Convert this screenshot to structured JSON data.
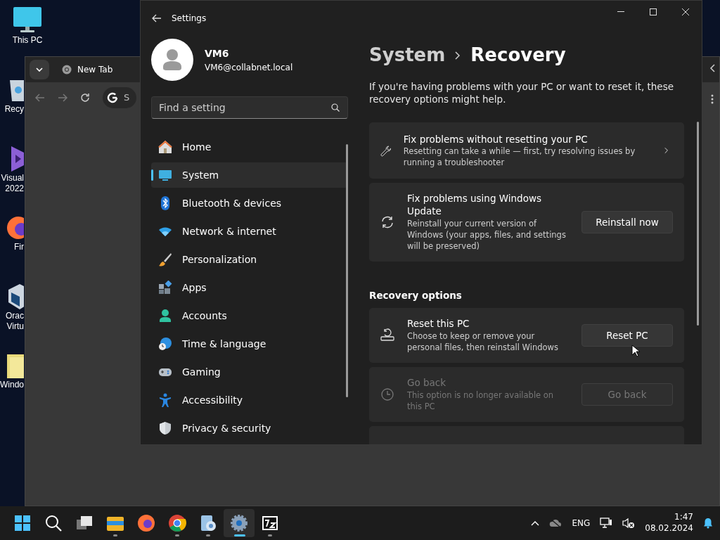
{
  "desktop_icons": [
    {
      "lines": [
        "This PC"
      ]
    },
    {
      "lines": [
        "Recy"
      ]
    },
    {
      "lines": [
        "Visual",
        "2022"
      ]
    },
    {
      "lines": [
        "Fir"
      ]
    },
    {
      "lines": [
        "Orac",
        "Virtu"
      ]
    },
    {
      "lines": [
        "Windo"
      ]
    }
  ],
  "browser": {
    "tab_title": "New Tab",
    "address_text": "S"
  },
  "settings": {
    "title": "Settings",
    "user": {
      "name": "VM6",
      "email": "VM6@collabnet.local"
    },
    "search": {
      "placeholder": "Find a setting"
    },
    "nav": [
      {
        "label": "Home",
        "selected": false
      },
      {
        "label": "System",
        "selected": true
      },
      {
        "label": "Bluetooth & devices",
        "selected": false
      },
      {
        "label": "Network & internet",
        "selected": false
      },
      {
        "label": "Personalization",
        "selected": false
      },
      {
        "label": "Apps",
        "selected": false
      },
      {
        "label": "Accounts",
        "selected": false
      },
      {
        "label": "Time & language",
        "selected": false
      },
      {
        "label": "Gaming",
        "selected": false
      },
      {
        "label": "Accessibility",
        "selected": false
      },
      {
        "label": "Privacy & security",
        "selected": false
      }
    ],
    "breadcrumb": [
      "System",
      "Recovery"
    ],
    "intro": "If you're having problems with your PC or want to reset it, these recovery options might help.",
    "cards": [
      {
        "kind": "link",
        "title": "Fix problems without resetting your PC",
        "description": "Resetting can take a while — first, try resolving issues by running a troubleshooter",
        "disabled": false
      },
      {
        "kind": "button",
        "title": "Fix problems using Windows Update",
        "description": "Reinstall your current version of Windows (your apps, files, and settings will be preserved)",
        "button": "Reinstall now",
        "disabled": false
      }
    ],
    "section_heading": "Recovery options",
    "options": [
      {
        "kind": "button",
        "title": "Reset this PC",
        "description": "Choose to keep or remove your personal files, then reinstall Windows",
        "button": "Reset PC",
        "disabled": false
      },
      {
        "kind": "button",
        "title": "Go back",
        "description": "This option is no longer available on this PC",
        "button": "Go back",
        "disabled": true
      },
      {
        "kind": "partial"
      }
    ]
  },
  "taskbar": {
    "apps": [
      {
        "running": false,
        "selected": false
      },
      {
        "running": false,
        "selected": false
      },
      {
        "running": false,
        "selected": false
      },
      {
        "running": true,
        "selected": false
      },
      {
        "running": false,
        "selected": false
      },
      {
        "running": true,
        "selected": false
      },
      {
        "running": true,
        "selected": false
      },
      {
        "running": true,
        "selected": true
      },
      {
        "running": true,
        "selected": false
      }
    ],
    "language": "ENG",
    "time": "1:47",
    "date": "08.02.2024"
  }
}
